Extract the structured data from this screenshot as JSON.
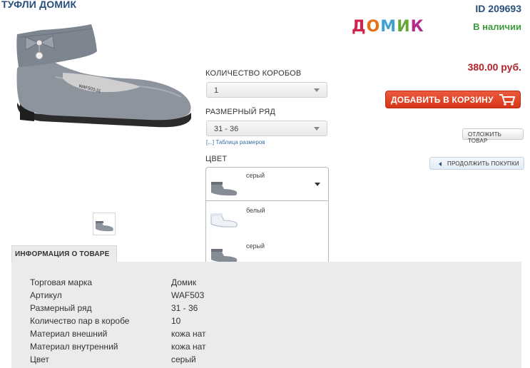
{
  "product": {
    "title": "ТУФЛИ ДОМИК",
    "id_label": "ID 209693",
    "stock_status": "В наличии",
    "price": "380.00 руб."
  },
  "brand": {
    "letters": [
      "Д",
      "О",
      "М",
      "И",
      "К"
    ],
    "colors": [
      "#d4234b",
      "#e56f1a",
      "#3fa0d6",
      "#68a63a",
      "#b12c8a"
    ]
  },
  "options": {
    "boxes_label": "КОЛИЧЕСТВО КОРОБОВ",
    "boxes_value": "1",
    "size_label": "РАЗМЕРНЫЙ РЯД",
    "size_value": "31 - 36",
    "size_table_link": "[...] Таблица размеров",
    "color_label": "ЦВЕТ",
    "color_selected": "серый",
    "color_options": [
      {
        "name": "белый"
      },
      {
        "name": "серый"
      }
    ]
  },
  "actions": {
    "add_to_cart": "ДОБАВИТЬ В КОРЗИНУ",
    "postpone": "ОТЛОЖИТЬ ТОВАР",
    "continue": "ПРОДОЛЖИТЬ ПОКУПКИ"
  },
  "info": {
    "tab_label": "ИНФОРМАЦИЯ О ТОВАРЕ",
    "specs": [
      {
        "key": "Торговая марка",
        "value": "Домик"
      },
      {
        "key": "Артикул",
        "value": "WAF503"
      },
      {
        "key": "Размерный ряд",
        "value": "31 - 36"
      },
      {
        "key": "Количество пар в коробе",
        "value": "10"
      },
      {
        "key": "Материал внешний",
        "value": "кожа нат"
      },
      {
        "key": "Материал внутренний",
        "value": "кожа нат"
      },
      {
        "key": "Цвет",
        "value": "серый"
      }
    ]
  },
  "colors": {
    "title": "#2a4f7c",
    "price": "#b0232a",
    "stock": "#3c9a3c",
    "cart_button": "#e04a2c"
  }
}
